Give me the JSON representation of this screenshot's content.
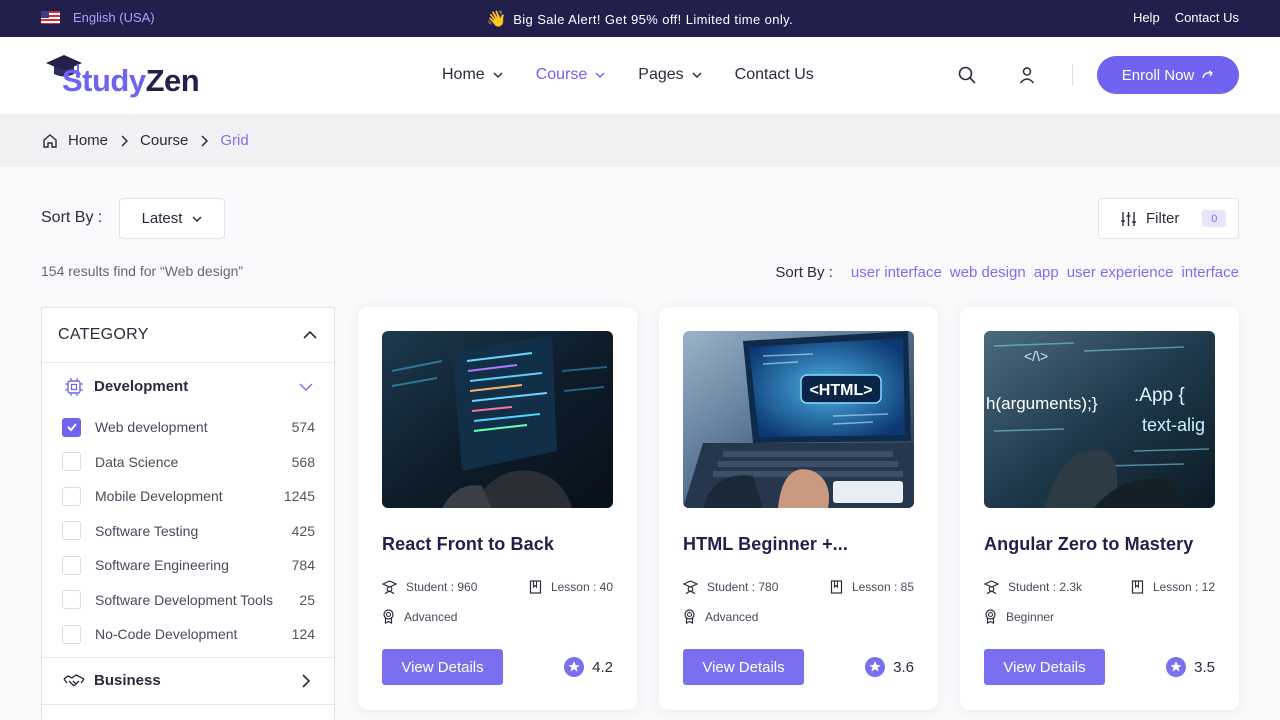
{
  "topbar": {
    "language": "English (USA)",
    "alert": "Big Sale Alert! Get 95% off! Limited time only.",
    "links": [
      "Help",
      "Contact Us"
    ]
  },
  "header": {
    "logo_part1": "Study",
    "logo_part2": "Zen",
    "nav": [
      {
        "label": "Home",
        "has_dropdown": true
      },
      {
        "label": "Course",
        "has_dropdown": true,
        "active": true
      },
      {
        "label": "Pages",
        "has_dropdown": true
      },
      {
        "label": "Contact Us",
        "has_dropdown": false
      }
    ],
    "enroll_label": "Enroll Now"
  },
  "breadcrumb": [
    "Home",
    "Course",
    "Grid"
  ],
  "toolbar": {
    "sort_label": "Sort By :",
    "sort_value": "Latest",
    "filter_label": "Filter",
    "filter_count": "0"
  },
  "results_text": "154 results find for “Web design”",
  "tags": {
    "label": "Sort By :",
    "items": [
      "user interface",
      "web design",
      "app",
      "user experience",
      "interface"
    ]
  },
  "sidebar": {
    "title": "CATEGORY",
    "groups": [
      {
        "label": "Development",
        "icon": "chip-icon",
        "expanded": true,
        "items": [
          {
            "label": "Web development",
            "count": "574",
            "checked": true
          },
          {
            "label": "Data Science",
            "count": "568",
            "checked": false
          },
          {
            "label": "Mobile Development",
            "count": "1245",
            "checked": false
          },
          {
            "label": "Software Testing",
            "count": "425",
            "checked": false
          },
          {
            "label": "Software Engineering",
            "count": "784",
            "checked": false
          },
          {
            "label": "Software Development Tools",
            "count": "25",
            "checked": false
          },
          {
            "label": "No-Code Development",
            "count": "124",
            "checked": false
          }
        ]
      },
      {
        "label": "Business",
        "icon": "handshake-icon",
        "expanded": false
      }
    ]
  },
  "courses": [
    {
      "title": "React Front to Back",
      "students": "Student : 960",
      "lessons": "Lesson : 40",
      "level": "Advanced",
      "rating": "4.2",
      "button": "View Details"
    },
    {
      "title": "HTML Beginner +...",
      "students": "Student : 780",
      "lessons": "Lesson : 85",
      "level": "Advanced",
      "rating": "3.6",
      "button": "View Details",
      "image_text": "<HTML>"
    },
    {
      "title": "Angular Zero to Mastery",
      "students": "Student : 2.3k",
      "lessons": "Lesson : 12",
      "level": "Beginner",
      "rating": "3.5",
      "button": "View Details",
      "image_text": [
        "</\\>",
        "h(arguments);}",
        ".App {",
        "text-alig"
      ]
    }
  ],
  "colors": {
    "accent": "#6f63f0",
    "topbar": "#221f4d",
    "breadcrumb_bg": "#f1f1f3"
  }
}
